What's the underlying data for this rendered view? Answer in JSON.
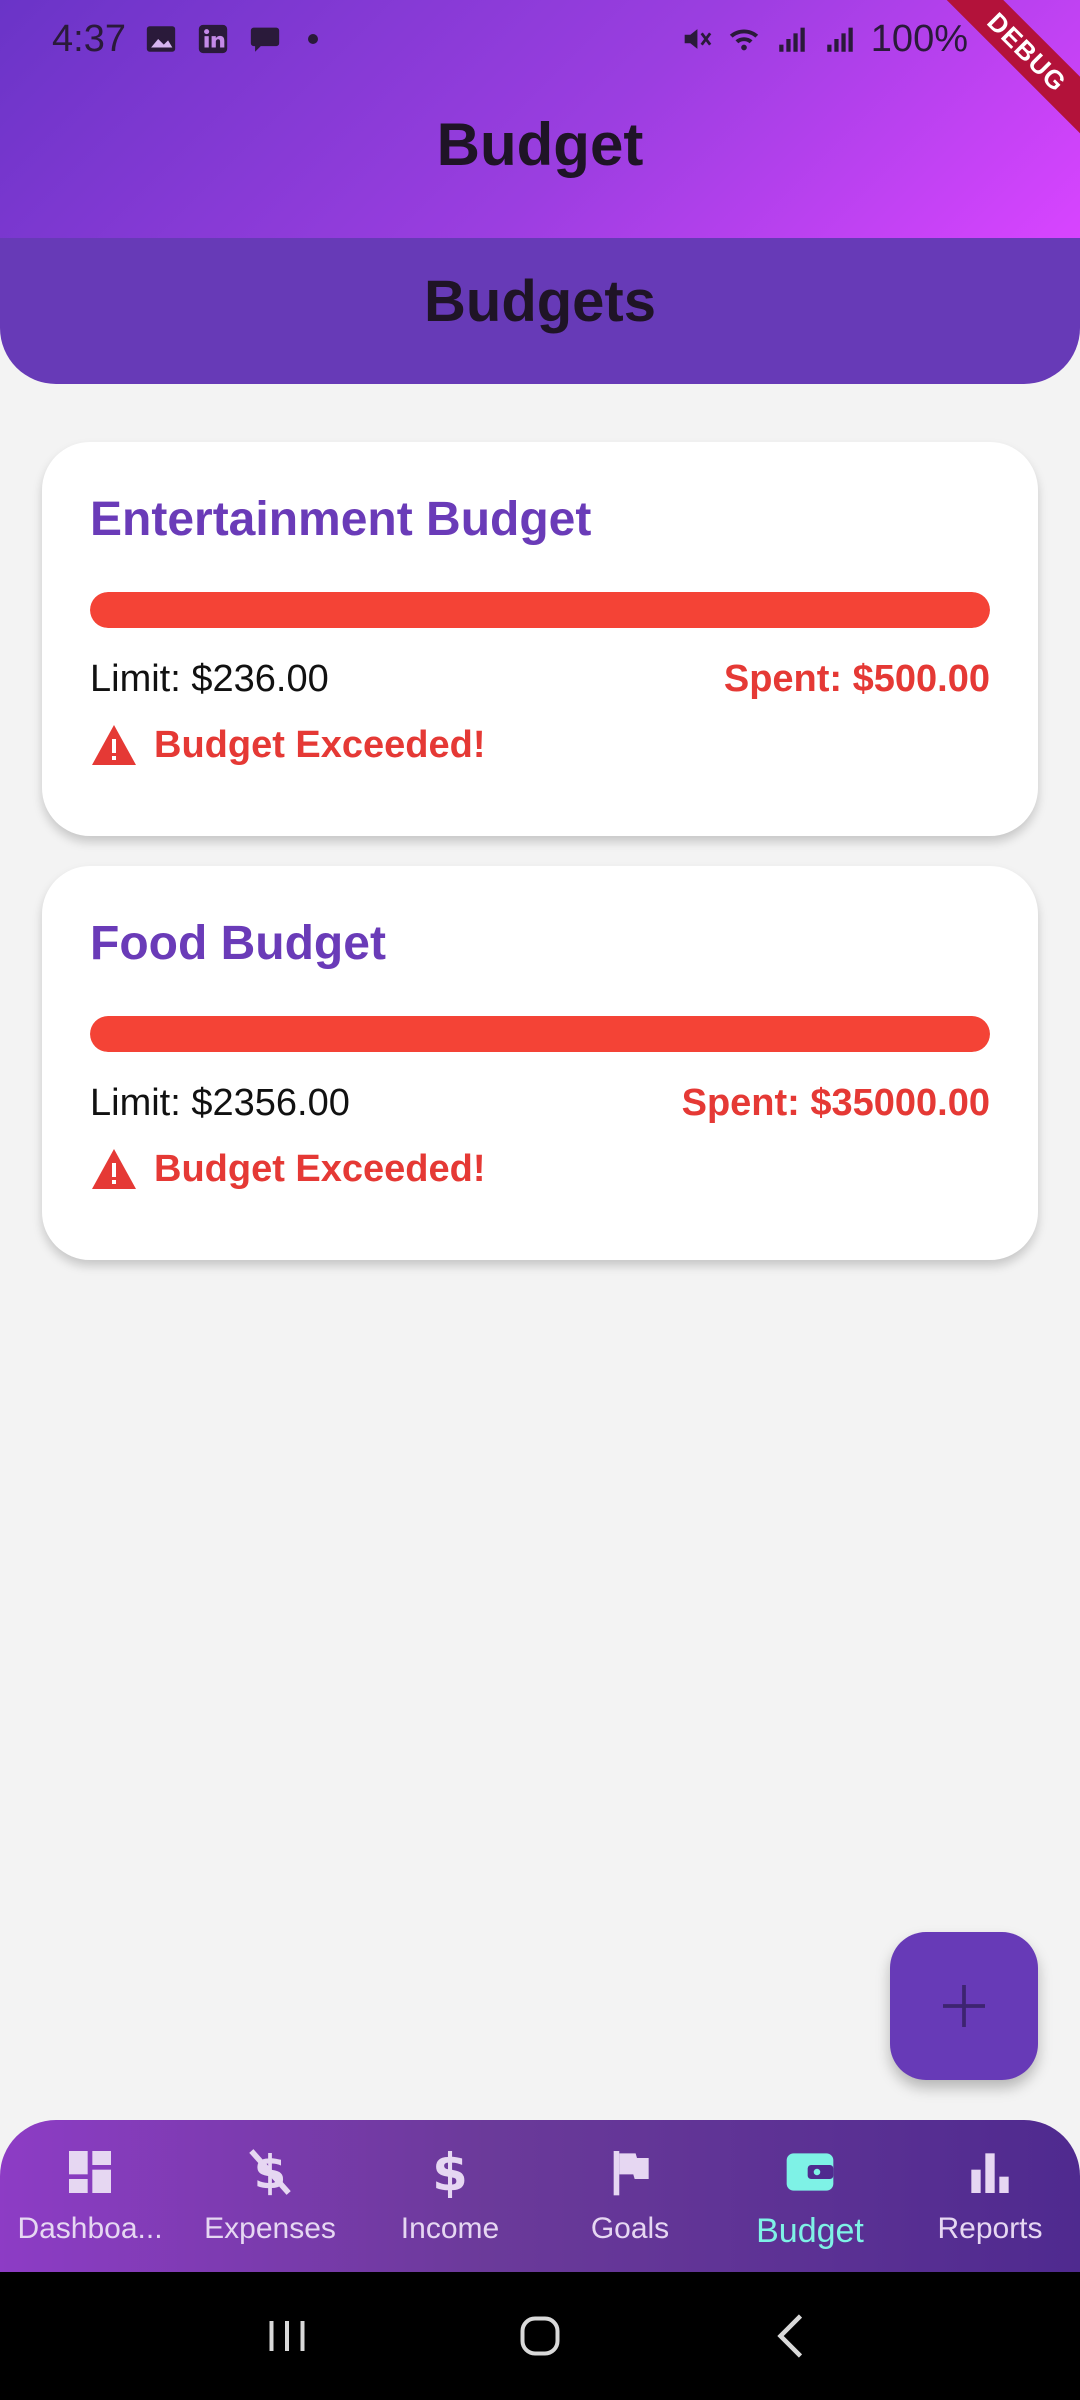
{
  "status_bar": {
    "time": "4:37",
    "battery": "100%",
    "ribbon": "DEBUG"
  },
  "app_bar": {
    "title": "Budget"
  },
  "section": {
    "title": "Budgets"
  },
  "budgets": [
    {
      "name": "Entertainment Budget",
      "limit": "Limit: $236.00",
      "spent": "Spent: $500.00",
      "warning": "Budget Exceeded!",
      "progress_percent": 100
    },
    {
      "name": "Food Budget",
      "limit": "Limit: $2356.00",
      "spent": "Spent: $35000.00",
      "warning": "Budget Exceeded!",
      "progress_percent": 100
    }
  ],
  "fab": {
    "icon": "plus-icon"
  },
  "bottom_nav": {
    "items": [
      {
        "label": "Dashboa...",
        "icon": "dashboard-icon",
        "active": false
      },
      {
        "label": "Expenses",
        "icon": "money-off-icon",
        "active": false
      },
      {
        "label": "Income",
        "icon": "dollar-icon",
        "active": false
      },
      {
        "label": "Goals",
        "icon": "flag-icon",
        "active": false
      },
      {
        "label": "Budget",
        "icon": "wallet-icon",
        "active": true
      },
      {
        "label": "Reports",
        "icon": "bar-chart-icon",
        "active": false
      }
    ]
  },
  "colors": {
    "primary": "#673ab7",
    "danger": "#f44336",
    "active_nav": "#7ef2e6"
  }
}
